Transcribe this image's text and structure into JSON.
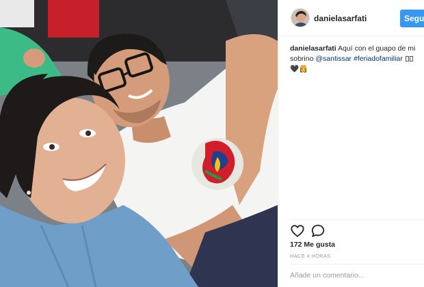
{
  "post": {
    "username": "danielasarfati",
    "follow_label": "Seguir",
    "caption": {
      "author": "danielasarfati",
      "text_before": "Aquí con el guapo de mi sobrino",
      "mention": "@santissar",
      "hashtag": "#feriadofamiliar",
      "emoji_trailing": "🖤👸"
    },
    "likes": "172 Me gusta",
    "time": "HACE 4 HORAS",
    "comment_placeholder": "Añade un comentario..."
  },
  "icons": {
    "like": "heart-outline-icon",
    "comment": "speech-bubble-icon"
  },
  "colors": {
    "follow_button": "#3897f0",
    "link": "#003569",
    "muted_text": "#999999",
    "divider": "#efefef"
  }
}
